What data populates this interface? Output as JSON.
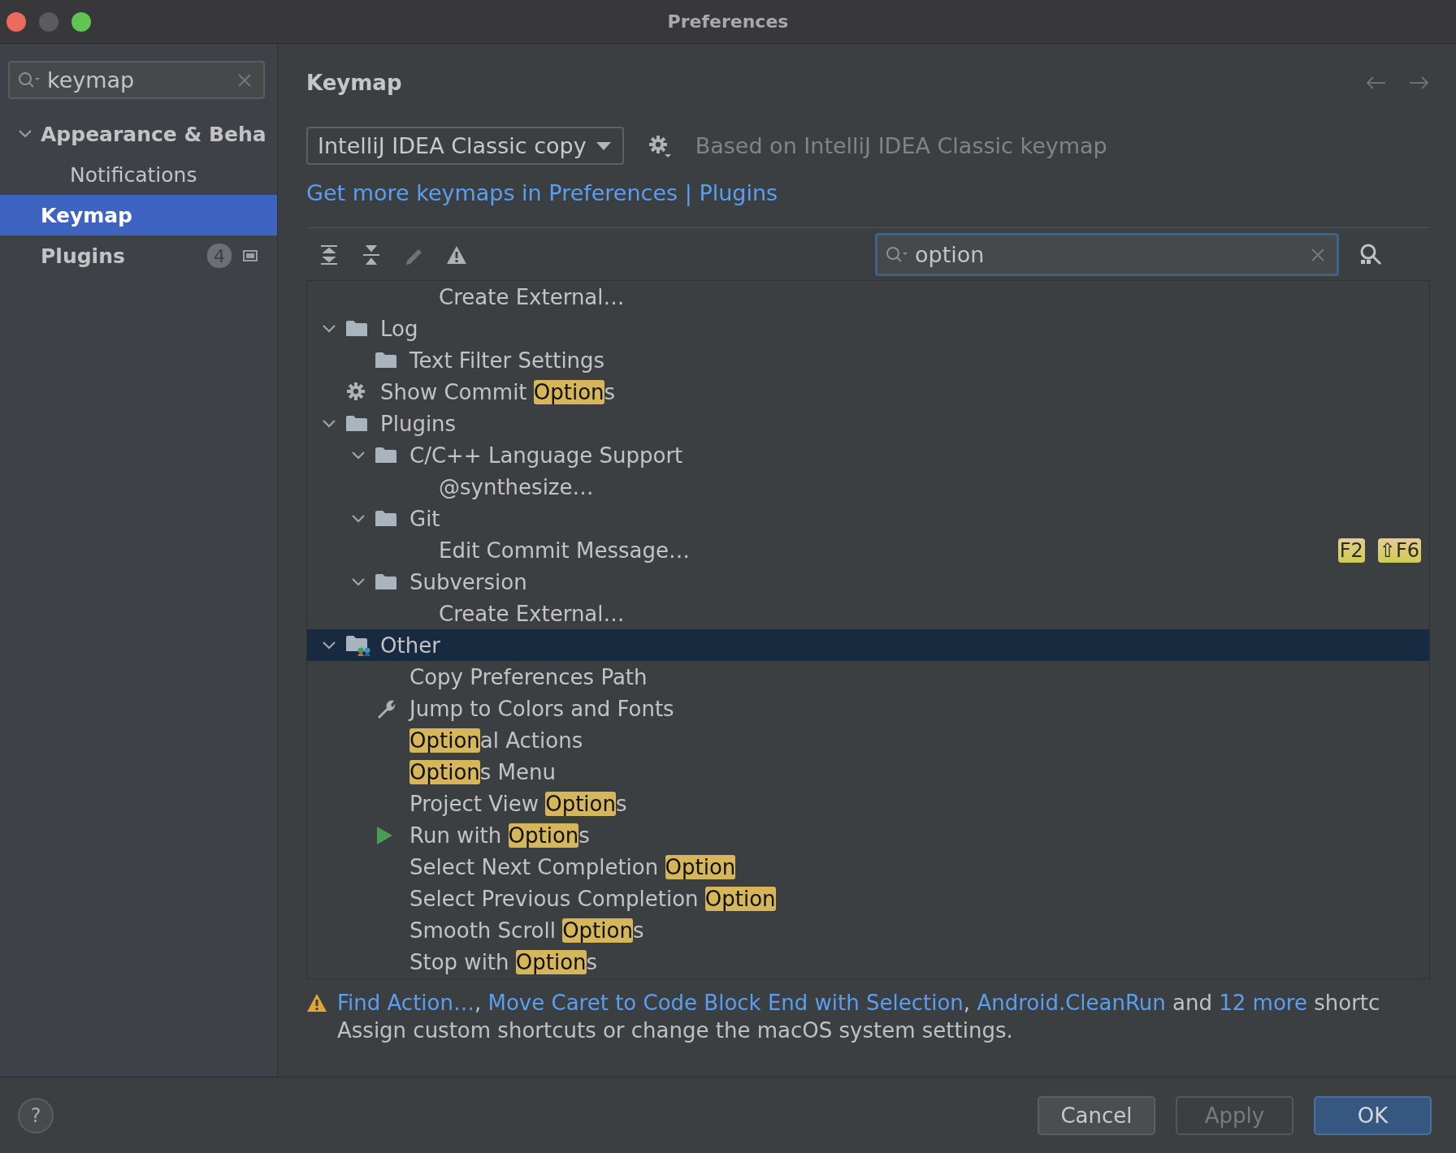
{
  "window": {
    "title": "Preferences"
  },
  "sidebar": {
    "search": {
      "value": "keymap"
    },
    "items": [
      {
        "label": "Appearance & Beha",
        "selected": false,
        "expanded": true,
        "children": [
          {
            "label": "Notifications",
            "selected": false
          }
        ]
      },
      {
        "label": "Keymap",
        "selected": true
      },
      {
        "label": "Plugins",
        "selected": false,
        "badge": "4"
      }
    ]
  },
  "keymap": {
    "title": "Keymap",
    "keymap_select": {
      "value": "IntelliJ IDEA Classic copy"
    },
    "based_on": "Based on IntelliJ IDEA Classic keymap",
    "plugins_link": "Get more keymaps in Preferences | Plugins",
    "toolbar": [
      {
        "kind": "expand_all",
        "disabled": false
      },
      {
        "kind": "collapse_all",
        "disabled": false
      },
      {
        "kind": "edit",
        "disabled": true
      },
      {
        "kind": "conflicts",
        "disabled": false
      }
    ],
    "action_search": {
      "value": "option"
    },
    "tree": [
      {
        "kind": "hidden",
        "children": [
          {
            "kind": "hidden",
            "children": [
              {
                "label": "Create External…",
                "kind": "action",
                "selected": false
              }
            ]
          }
        ]
      },
      {
        "label": "Log",
        "kind": "group",
        "selected": false,
        "expanded": true,
        "children": [
          {
            "label": "Text Filter Settings",
            "kind": "group",
            "selected": false
          }
        ]
      },
      {
        "parts": [
          {
            "text": "Show Commit ",
            "highlight": false
          },
          {
            "text": "Option",
            "highlight": true
          },
          {
            "text": "s",
            "highlight": false
          }
        ],
        "kind": "config_action",
        "selected": false
      },
      {
        "label": "Plugins",
        "kind": "group",
        "selected": false,
        "expanded": true,
        "children": [
          {
            "label": "C/C++ Language Support",
            "kind": "group",
            "selected": false,
            "expanded": true,
            "children": [
              {
                "label": "@synthesize…",
                "kind": "action",
                "selected": false
              }
            ]
          },
          {
            "label": "Git",
            "kind": "group",
            "selected": false,
            "expanded": true,
            "children": [
              {
                "label": "Edit Commit Message…",
                "kind": "action",
                "selected": false,
                "shortcuts": [
                  "F2",
                  "⇧F6"
                ]
              }
            ]
          },
          {
            "label": "Subversion",
            "kind": "group",
            "selected": false,
            "expanded": true,
            "children": [
              {
                "label": "Create External…",
                "kind": "action",
                "selected": false
              }
            ]
          }
        ]
      },
      {
        "label": "Other",
        "kind": "other_group",
        "selected": true,
        "expanded": true,
        "children": [
          {
            "label": "Copy Preferences Path",
            "kind": "action",
            "selected": false
          },
          {
            "label": "Jump to Colors and Fonts",
            "kind": "tool_action",
            "selected": false
          },
          {
            "parts": [
              {
                "text": "Option",
                "highlight": true
              },
              {
                "text": "al Actions",
                "highlight": false
              }
            ],
            "kind": "action",
            "selected": false
          },
          {
            "parts": [
              {
                "text": "Option",
                "highlight": true
              },
              {
                "text": "s Menu",
                "highlight": false
              }
            ],
            "kind": "action",
            "selected": false
          },
          {
            "parts": [
              {
                "text": "Project View ",
                "highlight": false
              },
              {
                "text": "Option",
                "highlight": true
              },
              {
                "text": "s",
                "highlight": false
              }
            ],
            "kind": "action",
            "selected": false
          },
          {
            "parts": [
              {
                "text": "Run with ",
                "highlight": false
              },
              {
                "text": "Option",
                "highlight": true
              },
              {
                "text": "s",
                "highlight": false
              }
            ],
            "kind": "run_action",
            "selected": false
          },
          {
            "parts": [
              {
                "text": "Select Next Completion ",
                "highlight": false
              },
              {
                "text": "Option",
                "highlight": true
              }
            ],
            "kind": "action",
            "selected": false
          },
          {
            "parts": [
              {
                "text": "Select Previous Completion ",
                "highlight": false
              },
              {
                "text": "Option",
                "highlight": true
              }
            ],
            "kind": "action",
            "selected": false
          },
          {
            "parts": [
              {
                "text": "Smooth Scroll ",
                "highlight": false
              },
              {
                "text": "Option",
                "highlight": true
              },
              {
                "text": "s",
                "highlight": false
              }
            ],
            "kind": "action",
            "selected": false
          },
          {
            "parts": [
              {
                "text": "Stop with ",
                "highlight": false
              },
              {
                "text": "Option",
                "highlight": true
              },
              {
                "text": "s",
                "highlight": false
              }
            ],
            "kind": "action",
            "selected": false
          }
        ]
      }
    ],
    "conflict_warning": {
      "links": [
        {
          "text": "Find Action…",
          "after": ", "
        },
        {
          "text": "Move Caret to Code Block End with Selection",
          "after": ", "
        },
        {
          "text": "Android.CleanRun",
          "after": " and "
        },
        {
          "text": "12 more",
          "after": " shortc"
        }
      ]
    },
    "hint": "Assign custom shortcuts or change the macOS system settings."
  },
  "help_button": {
    "label": "?"
  },
  "buttons": [
    {
      "label": "Cancel",
      "kind": "normal",
      "disabled": false
    },
    {
      "label": "Apply",
      "kind": "normal",
      "disabled": true
    },
    {
      "label": "OK",
      "kind": "default",
      "disabled": false
    }
  ]
}
